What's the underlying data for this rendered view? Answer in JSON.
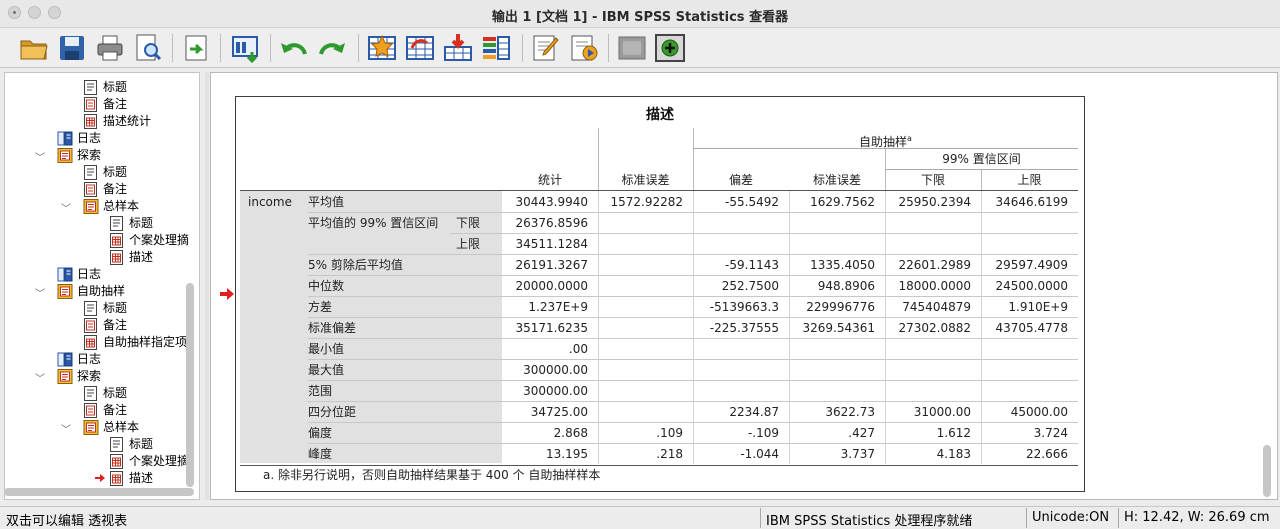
{
  "window": {
    "title": "输出 1 [文档 1] - IBM SPSS Statistics 查看器"
  },
  "toolbar": {
    "icons": [
      "open-folder-icon",
      "save-icon",
      "print-icon",
      "print-preview-icon",
      "export-icon",
      "recall-dialog-icon",
      "undo-icon",
      "redo-icon",
      "goto-data-icon",
      "goto-case-icon",
      "insert-variable-icon",
      "variables-icon",
      "edit-icon",
      "script-icon",
      "designate-window-icon",
      "add-icon"
    ]
  },
  "nav": {
    "items": [
      {
        "label": "标题",
        "icon": "title-doc-icon"
      },
      {
        "label": "备注",
        "icon": "notes-doc-icon"
      },
      {
        "label": "描述统计",
        "icon": "table-doc-icon"
      },
      {
        "label": "日志",
        "icon": "log-book-icon"
      },
      {
        "label": "探索",
        "icon": "procedure-icon"
      },
      {
        "label": "标题",
        "icon": "title-doc-icon"
      },
      {
        "label": "备注",
        "icon": "notes-doc-icon"
      },
      {
        "label": "总样本",
        "icon": "procedure-icon"
      },
      {
        "label": "标题",
        "icon": "title-doc-icon"
      },
      {
        "label": "个案处理摘",
        "icon": "table-doc-icon"
      },
      {
        "label": "描述",
        "icon": "table-doc-icon"
      },
      {
        "label": "日志",
        "icon": "log-book-icon"
      },
      {
        "label": "自助抽样",
        "icon": "procedure-icon"
      },
      {
        "label": "标题",
        "icon": "title-doc-icon"
      },
      {
        "label": "备注",
        "icon": "notes-doc-icon"
      },
      {
        "label": "自助抽样指定项",
        "icon": "table-doc-icon"
      },
      {
        "label": "日志",
        "icon": "log-book-icon"
      },
      {
        "label": "探索",
        "icon": "procedure-icon"
      },
      {
        "label": "标题",
        "icon": "title-doc-icon"
      },
      {
        "label": "备注",
        "icon": "notes-doc-icon"
      },
      {
        "label": "总样本",
        "icon": "procedure-icon"
      },
      {
        "label": "标题",
        "icon": "title-doc-icon"
      },
      {
        "label": "个案处理摘",
        "icon": "table-doc-icon"
      },
      {
        "label": "描述",
        "icon": "table-doc-icon"
      }
    ]
  },
  "table": {
    "title": "描述",
    "header": {
      "bootstrap": "自助抽样",
      "bootstrap_sup": "a",
      "ci": "99% 置信区间",
      "statistic": "统计",
      "std_error": "标准误差",
      "bias": "偏差",
      "boot_std_error": "标准误差",
      "lower": "下限",
      "upper": "上限"
    },
    "variable": "income",
    "rows": [
      {
        "label": "平均值",
        "sub": "",
        "stat": "30443.9940",
        "se": "1572.92282",
        "bias": "-55.5492",
        "bse": "1629.7562",
        "lo": "25950.2394",
        "hi": "34646.6199"
      },
      {
        "label": "平均值的 99% 置信区间",
        "sub": "下限",
        "stat": "26376.8596",
        "se": "",
        "bias": "",
        "bse": "",
        "lo": "",
        "hi": ""
      },
      {
        "label": "",
        "sub": "上限",
        "stat": "34511.1284",
        "se": "",
        "bias": "",
        "bse": "",
        "lo": "",
        "hi": ""
      },
      {
        "label": "5% 剪除后平均值",
        "sub": "",
        "stat": "26191.3267",
        "se": "",
        "bias": "-59.1143",
        "bse": "1335.4050",
        "lo": "22601.2989",
        "hi": "29597.4909"
      },
      {
        "label": "中位数",
        "sub": "",
        "stat": "20000.0000",
        "se": "",
        "bias": "252.7500",
        "bse": "948.8906",
        "lo": "18000.0000",
        "hi": "24500.0000"
      },
      {
        "label": "方差",
        "sub": "",
        "stat": "1.237E+9",
        "se": "",
        "bias": "-5139663.3",
        "bse": "229996776",
        "lo": "745404879",
        "hi": "1.910E+9"
      },
      {
        "label": "标准偏差",
        "sub": "",
        "stat": "35171.6235",
        "se": "",
        "bias": "-225.37555",
        "bse": "3269.54361",
        "lo": "27302.0882",
        "hi": "43705.4778"
      },
      {
        "label": "最小值",
        "sub": "",
        "stat": ".00",
        "se": "",
        "bias": "",
        "bse": "",
        "lo": "",
        "hi": ""
      },
      {
        "label": "最大值",
        "sub": "",
        "stat": "300000.00",
        "se": "",
        "bias": "",
        "bse": "",
        "lo": "",
        "hi": ""
      },
      {
        "label": "范围",
        "sub": "",
        "stat": "300000.00",
        "se": "",
        "bias": "",
        "bse": "",
        "lo": "",
        "hi": ""
      },
      {
        "label": "四分位距",
        "sub": "",
        "stat": "34725.00",
        "se": "",
        "bias": "2234.87",
        "bse": "3622.73",
        "lo": "31000.00",
        "hi": "45000.00"
      },
      {
        "label": "偏度",
        "sub": "",
        "stat": "2.868",
        "se": ".109",
        "bias": "-.109",
        "bse": ".427",
        "lo": "1.612",
        "hi": "3.724"
      },
      {
        "label": "峰度",
        "sub": "",
        "stat": "13.195",
        "se": ".218",
        "bias": "-1.044",
        "bse": "3.737",
        "lo": "4.183",
        "hi": "22.666"
      }
    ],
    "footnote": "a. 除非另行说明，否则自助抽样结果基于 400 个 自助抽样样本"
  },
  "status": {
    "hint": "双击可以编辑 透视表",
    "processor": "IBM SPSS Statistics 处理程序就绪",
    "unicode": "Unicode:ON",
    "size": "H: 12.42, W: 26.69 cm"
  }
}
